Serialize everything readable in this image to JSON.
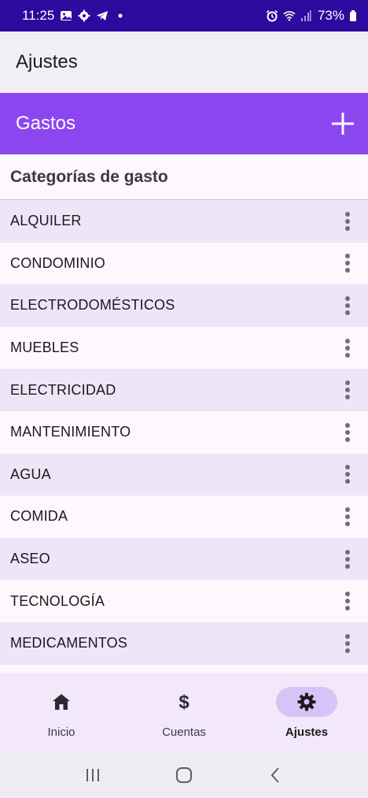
{
  "status_bar": {
    "time": "11:25",
    "battery": "73%",
    "icons_left": [
      "gallery-icon",
      "settings-gear-icon",
      "telegram-icon",
      "dot-icon"
    ],
    "icons_right": [
      "alarm-icon",
      "wifi-icon",
      "signal-icon",
      "battery-icon"
    ]
  },
  "app_bar": {
    "title": "Ajustes"
  },
  "section": {
    "title": "Gastos",
    "add_icon": "plus-icon",
    "color": "#8b46f0"
  },
  "subheader": {
    "title": "Categorías de gasto"
  },
  "categories": [
    {
      "label": "ALQUILER"
    },
    {
      "label": "CONDOMINIO"
    },
    {
      "label": "ELECTRODOMÉSTICOS"
    },
    {
      "label": "MUEBLES"
    },
    {
      "label": "ELECTRICIDAD"
    },
    {
      "label": "MANTENIMIENTO"
    },
    {
      "label": "AGUA"
    },
    {
      "label": "COMIDA"
    },
    {
      "label": "ASEO"
    },
    {
      "label": "TECNOLOGÍA"
    },
    {
      "label": "MEDICAMENTOS"
    }
  ],
  "bottom_nav": {
    "items": [
      {
        "label": "Inicio",
        "icon": "home-icon",
        "active": false
      },
      {
        "label": "Cuentas",
        "icon": "dollar-icon",
        "active": false
      },
      {
        "label": "Ajustes",
        "icon": "gear-icon",
        "active": true
      }
    ]
  },
  "system_nav": {
    "icons": [
      "recent-apps-icon",
      "home-button-icon",
      "back-icon"
    ]
  }
}
